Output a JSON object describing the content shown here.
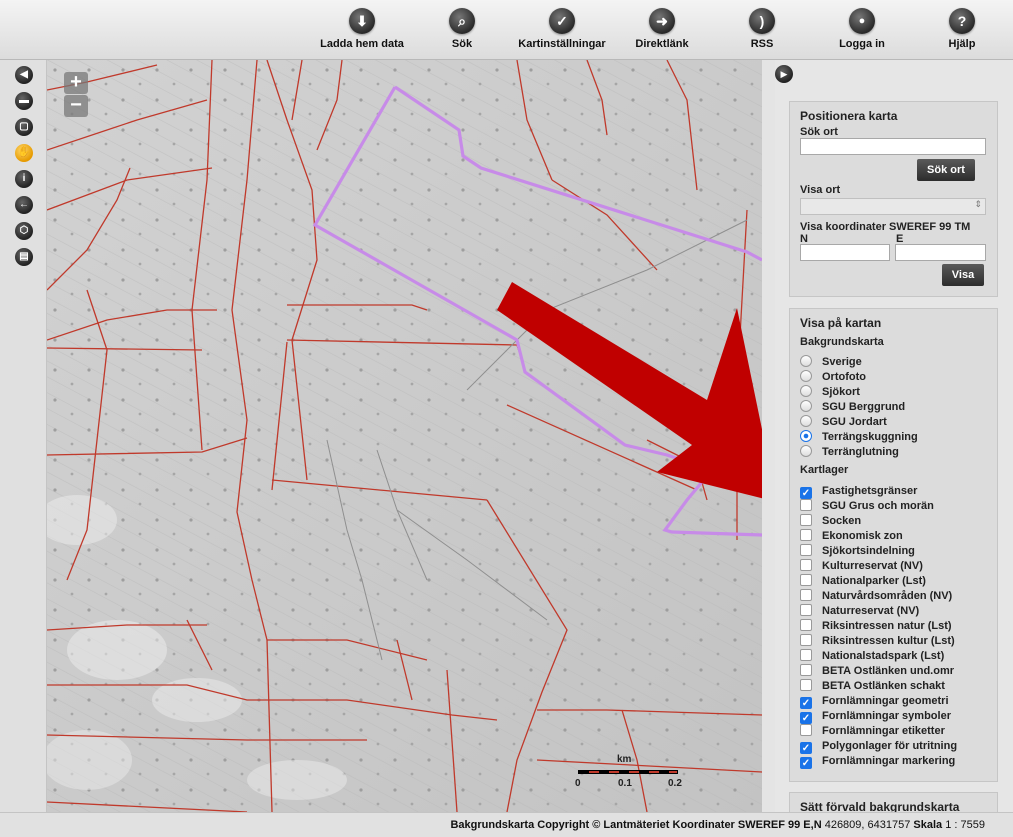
{
  "toolbar": {
    "buttons": [
      {
        "label": "Ladda hem data",
        "icon": "download-icon",
        "glyph": "⬇"
      },
      {
        "label": "Sök",
        "icon": "search-icon",
        "glyph": "⌕"
      },
      {
        "label": "Kartinställningar",
        "icon": "settings-check-icon",
        "glyph": "✓"
      },
      {
        "label": "Direktlänk",
        "icon": "direct-link-icon",
        "glyph": "➜"
      },
      {
        "label": "RSS",
        "icon": "rss-icon",
        "glyph": ")"
      },
      {
        "label": "Logga in",
        "icon": "lock-icon",
        "glyph": "🔒"
      },
      {
        "label": "Hjälp",
        "icon": "help-icon",
        "glyph": "?"
      }
    ]
  },
  "left_tools": [
    {
      "name": "collapse-left-icon",
      "glyph": "◀"
    },
    {
      "name": "ruler-icon",
      "glyph": "▬"
    },
    {
      "name": "zoom-box-icon",
      "glyph": "▢"
    },
    {
      "name": "pan-hand-icon",
      "glyph": "✋"
    },
    {
      "name": "info-icon",
      "glyph": "i"
    },
    {
      "name": "back-arrow-icon",
      "glyph": "←"
    },
    {
      "name": "polygon-icon",
      "glyph": "⬡"
    },
    {
      "name": "print-icon",
      "glyph": "▤"
    }
  ],
  "map": {
    "zoom_in": "+",
    "zoom_out": "−",
    "scale": {
      "unit": "km",
      "ticks": [
        "0",
        "0.1",
        "0.2"
      ]
    }
  },
  "position_panel": {
    "title": "Positionera karta",
    "search_label": "Sök ort",
    "search_value": "",
    "search_button": "Sök ort",
    "show_label": "Visa ort",
    "show_value": "",
    "coords_label": "Visa koordinater SWEREF 99 TM",
    "n_label": "N",
    "e_label": "E",
    "n_value": "",
    "e_value": "",
    "show_button": "Visa"
  },
  "layers_panel": {
    "title": "Visa på kartan",
    "background_title": "Bakgrundskarta",
    "backgrounds": [
      {
        "label": "Sverige",
        "selected": false
      },
      {
        "label": "Ortofoto",
        "selected": false
      },
      {
        "label": "Sjökort",
        "selected": false
      },
      {
        "label": "SGU Berggrund",
        "selected": false
      },
      {
        "label": "SGU Jordart",
        "selected": false
      },
      {
        "label": "Terrängskuggning",
        "selected": true
      },
      {
        "label": "Terränglutning",
        "selected": false
      }
    ],
    "layers_title": "Kartlager",
    "layers": [
      {
        "label": "Fastighetsgränser",
        "checked": true
      },
      {
        "label": "SGU Grus och morän",
        "checked": false
      },
      {
        "label": "Socken",
        "checked": false
      },
      {
        "label": "Ekonomisk zon",
        "checked": false
      },
      {
        "label": "Sjökortsindelning",
        "checked": false
      },
      {
        "label": "Kulturreservat (NV)",
        "checked": false
      },
      {
        "label": "Nationalparker (Lst)",
        "checked": false
      },
      {
        "label": "Naturvårdsområden (NV)",
        "checked": false
      },
      {
        "label": "Naturreservat (NV)",
        "checked": false
      },
      {
        "label": "Riksintressen natur (Lst)",
        "checked": false
      },
      {
        "label": "Riksintressen kultur (Lst)",
        "checked": false
      },
      {
        "label": "Nationalstadspark (Lst)",
        "checked": false
      },
      {
        "label": "BETA Ostlänken und.omr",
        "checked": false
      },
      {
        "label": "BETA Ostlänken schakt",
        "checked": false
      },
      {
        "label": "Fornlämningar geometri",
        "checked": true
      },
      {
        "label": "Fornlämningar symboler",
        "checked": true
      },
      {
        "label": "Fornlämningar etiketter",
        "checked": false
      },
      {
        "label": "Polygonlager för utritning",
        "checked": true
      },
      {
        "label": "Fornlämningar markering",
        "checked": true
      }
    ]
  },
  "default_bg_panel": {
    "title": "Sätt förvald bakgrundskarta"
  },
  "status": {
    "copyright": "Bakgrundskarta Copyright © Lantmäteriet",
    "coord_label": "Koordinater SWEREF 99 E,N",
    "coord_value": "426809, 6431757",
    "scale_label": "Skala",
    "scale_value": "1 : 7559"
  },
  "colors": {
    "property_line": "#c0392b",
    "polygon": "#c78be8",
    "arrow": "#c00000",
    "accent": "#1a73e8"
  }
}
